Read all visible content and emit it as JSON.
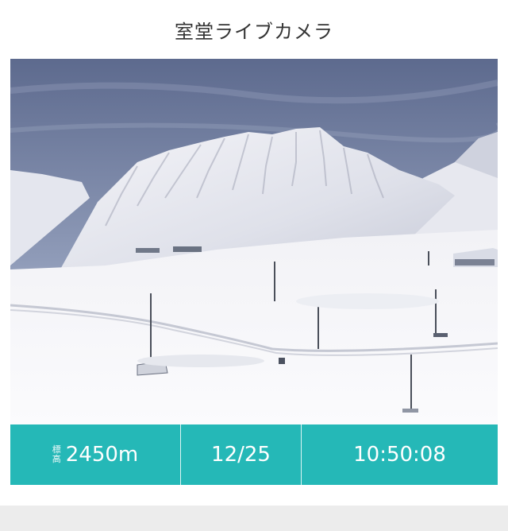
{
  "page": {
    "title": "室堂ライブカメラ"
  },
  "info": {
    "elevation_label_top": "標",
    "elevation_label_bottom": "高",
    "elevation_value": "2450m",
    "date": "12/25",
    "time": "10:50:08"
  },
  "colors": {
    "accent": "#25b8b7",
    "background": "#ffffff",
    "title_text": "#333333"
  }
}
